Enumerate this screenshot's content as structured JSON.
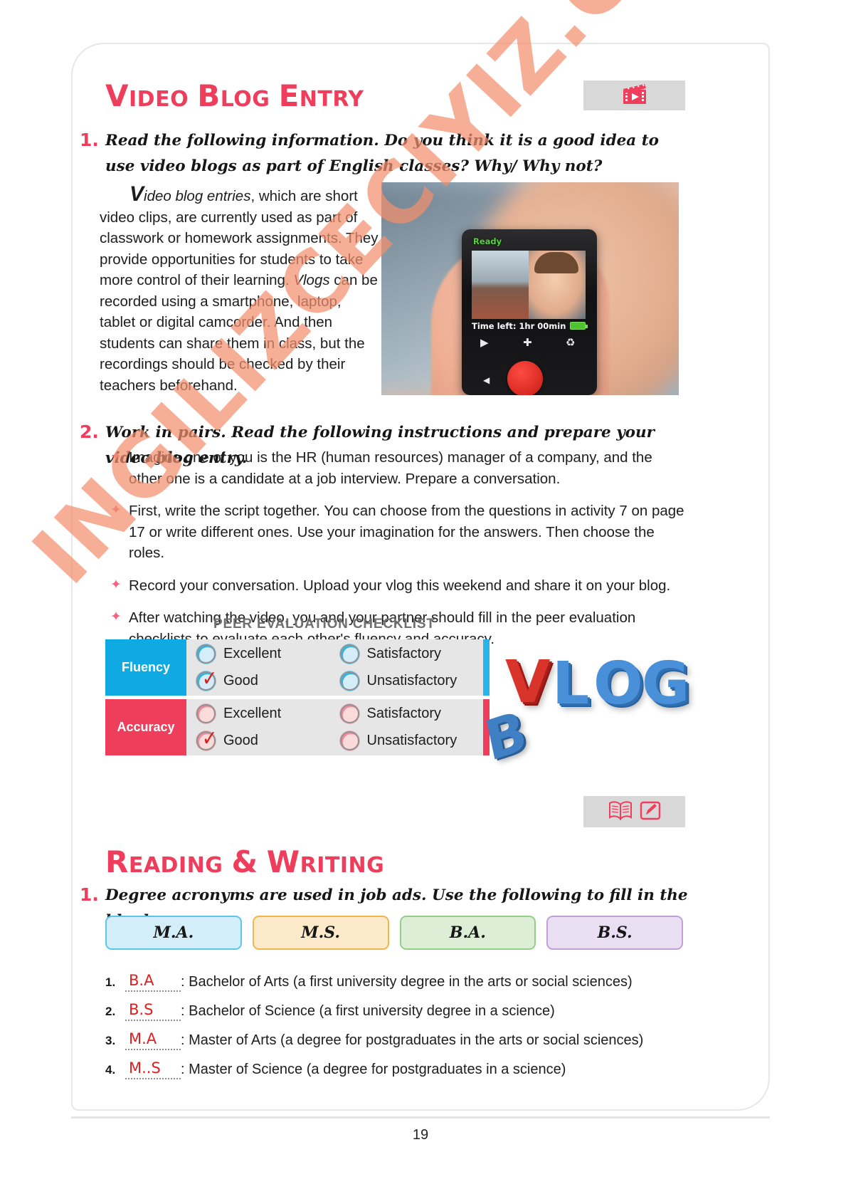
{
  "page": {
    "number": "19"
  },
  "section_video": {
    "heading_parts": [
      {
        "cap": "V",
        "rest": "IDEO"
      },
      {
        "cap": "B",
        "rest": "LOG"
      },
      {
        "cap": "E",
        "rest": "NTRY"
      }
    ],
    "icon": "film-clapper-play-icon",
    "exercise1": {
      "number": "1.",
      "instruction": "Read the following information. Do you think it is a good idea to use video blogs as part of English classes? Why/ Why not?",
      "paragraph_dropcap": "V",
      "paragraph_italic_lead": "ideo blog entries",
      "paragraph_rest_1": ", which are short video clips, are currently used as part of classwork or homework assignments. They provide opportunities for students to take more control of their learning. ",
      "paragraph_italic_2": "Vlogs",
      "paragraph_rest_2": " can be recorded using a smartphone, laptop, tablet or digital camcorder. And then students can share them in class, but the recordings should be checked by their teachers beforehand."
    },
    "photo": {
      "status_label": "Ready",
      "time_label": "Time left: 1hr 00min",
      "play_glyph": "▶",
      "plus_glyph": "✚",
      "trash_glyph": "♻",
      "left_glyph": "◀"
    },
    "exercise2": {
      "number": "2.",
      "instruction": "Work in pairs. Read the following instructions and prepare your video blog entry.",
      "bullet_mark": "✦",
      "bullets": [
        "Imagine one of you is the HR (human resources) manager of a company, and the other one is a candidate at a job interview. Prepare a conversation.",
        "First, write the script together. You can choose from the questions in activity 7 on page 17 or write different ones. Use your imagination for the answers. Then choose the roles.",
        "Record your conversation. Upload your vlog this weekend and share it on your blog.",
        "After watching the video, you and your partner should fill in the peer evaluation checklists to evaluate each other's fluency and accuracy."
      ]
    },
    "checklist": {
      "title": "PEER EVALUATION CHECKLIST",
      "rows": [
        {
          "label": "Fluency",
          "label_color": "#0fa9e3",
          "circle_style": "blue",
          "options": [
            {
              "text": "Excellent",
              "checked": false
            },
            {
              "text": "Satisfactory",
              "checked": false
            },
            {
              "text": "Good",
              "checked": true
            },
            {
              "text": "Unsatisfactory",
              "checked": false
            }
          ]
        },
        {
          "label": "Accuracy",
          "label_color": "#ef3e5c",
          "circle_style": "pink",
          "options": [
            {
              "text": "Excellent",
              "checked": false
            },
            {
              "text": "Satisfactory",
              "checked": false
            },
            {
              "text": "Good",
              "checked": true
            },
            {
              "text": "Unsatisfactory",
              "checked": false
            }
          ]
        }
      ],
      "check_glyph": "✓"
    },
    "vlog_art": {
      "letters": [
        "V",
        "L",
        "O",
        "G"
      ],
      "fallen_letter": "B"
    }
  },
  "section_reading": {
    "heading_parts": [
      {
        "cap": "R",
        "rest": "EADING"
      },
      {
        "cap": "&",
        "rest": ""
      },
      {
        "cap": "W",
        "rest": "RITING"
      }
    ],
    "icons": [
      "open-book-icon",
      "pencil-edit-icon"
    ],
    "exercise1": {
      "number": "1.",
      "instruction": "Degree acronyms are used in job ads. Use the following to fill in the blanks.",
      "acronym_boxes": [
        {
          "label": "M.A.",
          "color": "blue"
        },
        {
          "label": "M.S.",
          "color": "orange"
        },
        {
          "label": "B.A.",
          "color": "green"
        },
        {
          "label": "B.S.",
          "color": "purple"
        }
      ],
      "answers": [
        {
          "no": "1.",
          "filled": "B.A",
          "definition": ": Bachelor of Arts (a first university degree in the arts or social sciences)"
        },
        {
          "no": "2.",
          "filled": "B.S",
          "definition": ": Bachelor of Science (a first university degree in a science)"
        },
        {
          "no": "3.",
          "filled": "M.A",
          "definition": ": Master of Arts (a degree for postgraduates in the arts or social sciences)"
        },
        {
          "no": "4.",
          "filled": "M..S",
          "definition": ": Master of Science (a degree for postgraduates in a science)"
        }
      ]
    }
  },
  "watermark": {
    "text": "INGILIZCECIYIZ.COM"
  },
  "colors": {
    "accent_pink": "#ef3e5c",
    "accent_blue": "#0fa9e3",
    "answer_red": "#e02020",
    "watermark": "#f3906e"
  }
}
